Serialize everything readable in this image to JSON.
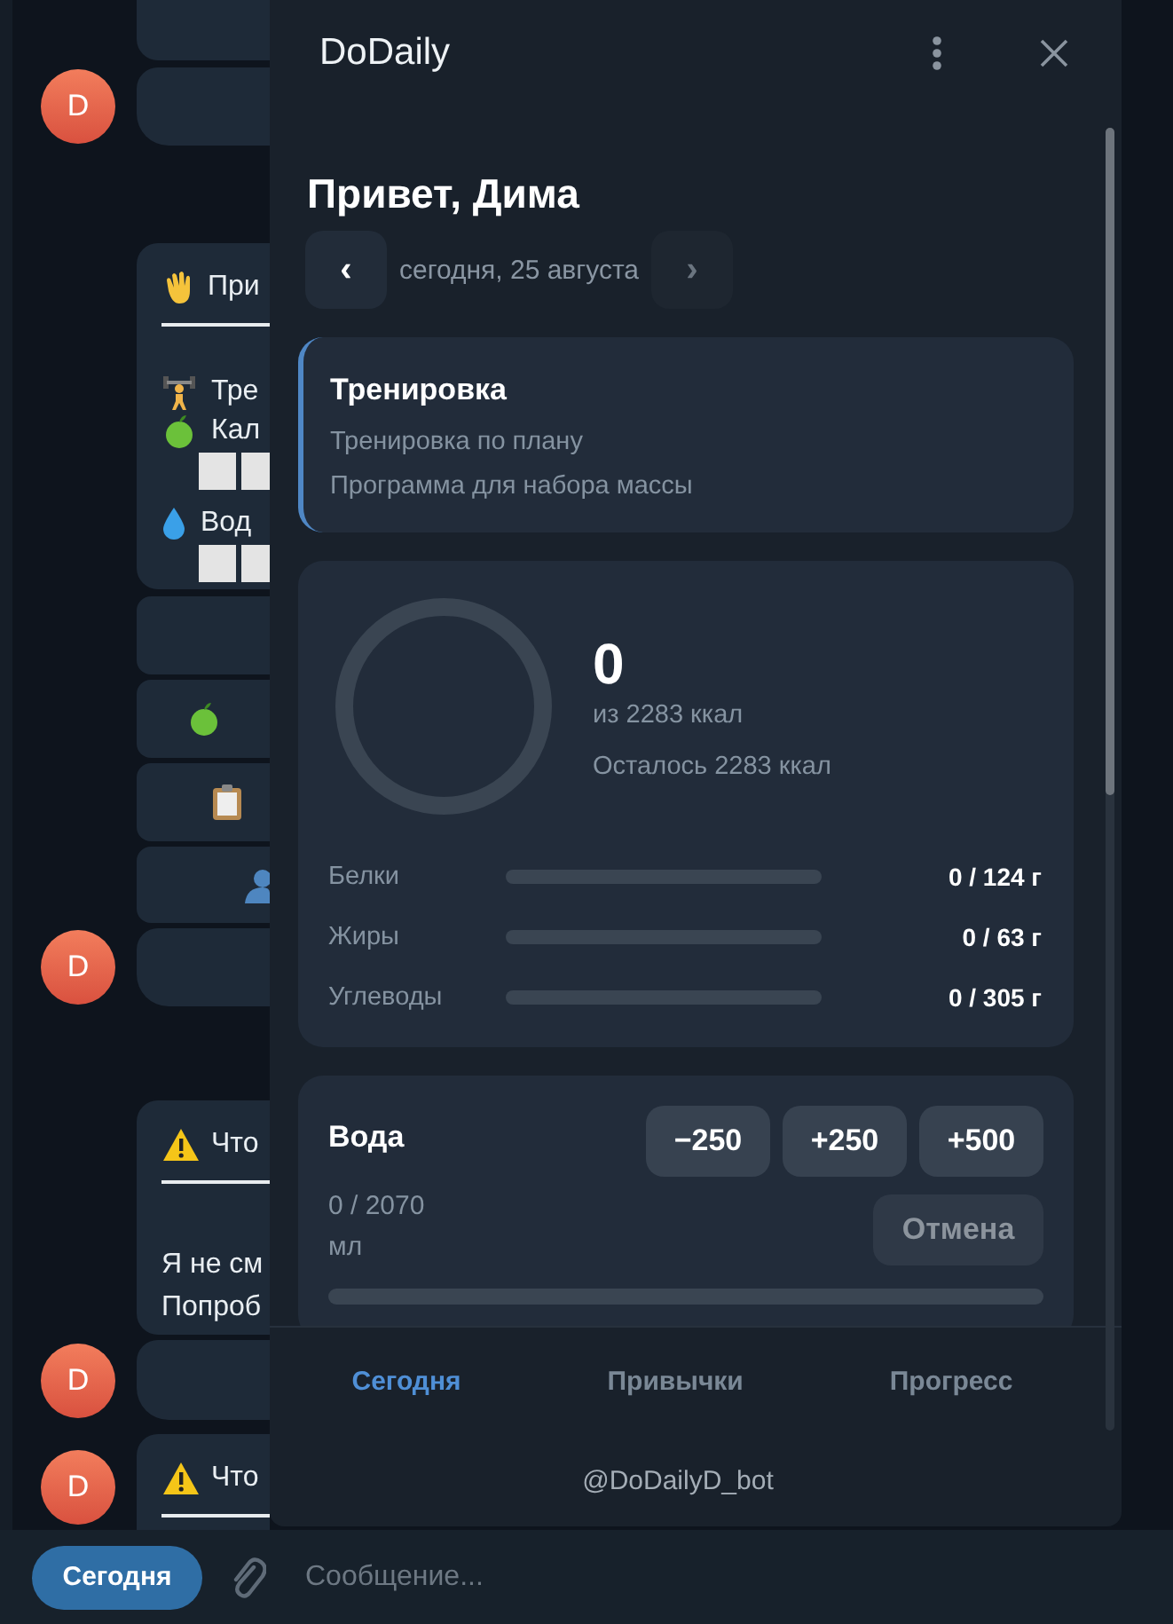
{
  "chat": {
    "messages": [
      {
        "kind": "bubble",
        "avatar": false
      },
      {
        "kind": "bubble",
        "avatar": true,
        "initial": "D"
      },
      {
        "kind": "card",
        "avatar": false,
        "header": "При",
        "lines": [
          {
            "kind": "text",
            "text": "Тре"
          },
          {
            "kind": "text",
            "text": "Кал"
          },
          {
            "kind": "squares"
          },
          {
            "kind": "text",
            "text": "Вод"
          },
          {
            "kind": "squares"
          }
        ]
      },
      {
        "kind": "key",
        "avatar": false
      },
      {
        "kind": "key",
        "avatar": false
      },
      {
        "kind": "key",
        "avatar": false
      },
      {
        "kind": "key",
        "avatar": false
      },
      {
        "kind": "bubble",
        "avatar": true,
        "initial": "D"
      },
      {
        "kind": "card",
        "avatar": false,
        "header": "Что",
        "lines": [
          {
            "kind": "text",
            "text": "Я не см"
          },
          {
            "kind": "text",
            "text": "Попроб"
          }
        ]
      },
      {
        "kind": "bubble",
        "avatar": true,
        "initial": "D"
      },
      {
        "kind": "card",
        "avatar": true,
        "initial": "D",
        "header": "Что"
      }
    ]
  },
  "composer": {
    "button": "Сегодня",
    "placeholder": "Сообщение..."
  },
  "app": {
    "title": "DoDaily",
    "greeting": "Привет, Дима",
    "date": {
      "prev": "‹",
      "label": "сегодня, 25 августа",
      "next": "›",
      "next_disabled": true
    },
    "workout": {
      "title": "Тренировка",
      "lines": [
        "Тренировка по плану",
        "Программа для набора массы"
      ]
    },
    "calories": {
      "value": "0",
      "goal": "из 2283 ккал",
      "remaining": "Осталось 2283 ккал",
      "macros": [
        {
          "label": "Белки",
          "level": 0,
          "reading": "0 / 124 г"
        },
        {
          "label": "Жиры",
          "level": 0,
          "reading": "0 / 63 г"
        },
        {
          "label": "Углеводы",
          "level": 0,
          "reading": "0 / 305 г"
        }
      ]
    },
    "water": {
      "title": "Вода",
      "amount": "0 / 2070 мл",
      "level": 0,
      "buttons": [
        {
          "label": "−250",
          "disabled": false
        },
        {
          "label": "+250",
          "disabled": false
        },
        {
          "label": "+500",
          "disabled": false
        },
        {
          "label": "Отмена",
          "disabled": true
        }
      ]
    },
    "tabs": [
      {
        "label": "Сегодня",
        "selected": true
      },
      {
        "label": "Привычки",
        "selected": false
      },
      {
        "label": "Прогресс",
        "selected": false
      }
    ],
    "footer": "@DoDailyD_bot"
  }
}
